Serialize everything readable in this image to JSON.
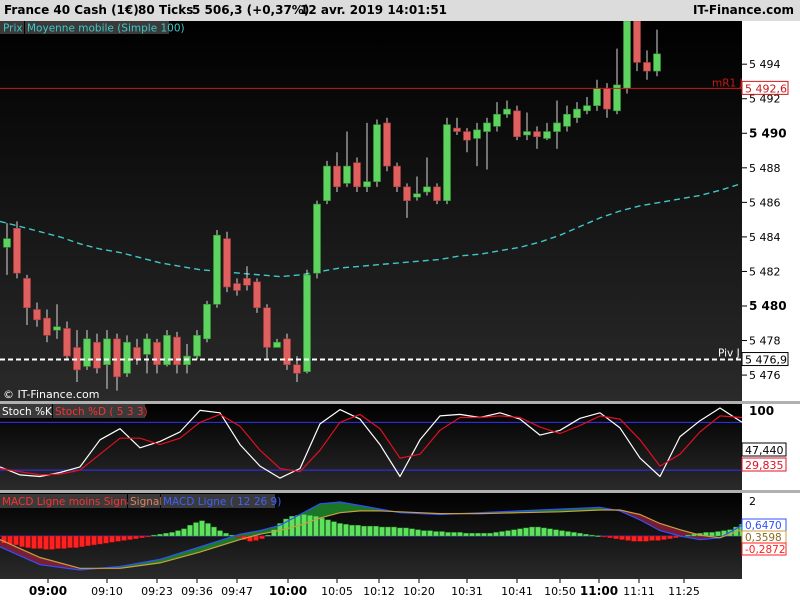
{
  "header": {
    "instrument": "France 40 Cash (1€)",
    "ticks": "80 Ticks",
    "price": "5 506,3 (+0,37%)",
    "datetime": "12 avr. 2019 14:01:51",
    "brand": "IT-Finance.com"
  },
  "watermark": "© IT-Finance.com",
  "price_panel": {
    "legend": [
      "Prix",
      "Moyenne mobile (Simple 100)"
    ],
    "levels": {
      "mr1": {
        "name": "mR1 J",
        "value": "5 492,6",
        "price": 5492.6
      },
      "piv": {
        "name": "Piv J",
        "value": "5 476,9",
        "price": 5476.9
      }
    }
  },
  "stoch_panel": {
    "legend": [
      "Stoch %K",
      "Stoch %D ( 5 3 3)"
    ],
    "readouts": [
      "47,440",
      "29,835"
    ],
    "top_label": "100"
  },
  "macd_panel": {
    "legend": [
      "MACD Ligne moins Signal",
      "Signal",
      "MACD Ligne ( 12 26 9)"
    ],
    "readouts": [
      "0,6470",
      "0,3598",
      "-0,2872"
    ],
    "top_label": "2"
  },
  "colors": {
    "bull": "#5fd35f",
    "bear": "#e06060",
    "ma": "#40c8c8",
    "resistance": "#c81818",
    "pivot": "#ffffff",
    "stoch_k": "#ffffff",
    "stoch_d": "#e01020",
    "macd_pos": "#5fe05f",
    "macd_neg": "#ff2020",
    "guide": "#3030ff"
  },
  "chart_data": [
    {
      "type": "candlestick",
      "ylim": [
        5474.5,
        5496.5
      ],
      "y_ticks": [
        "5 476",
        "5 478",
        "5 480",
        "5 482",
        "5 484",
        "5 486",
        "5 488",
        "5 490",
        "5 492",
        "5 494"
      ],
      "y_tick_values": [
        5476,
        5478,
        5480,
        5482,
        5484,
        5486,
        5488,
        5490,
        5492,
        5494
      ],
      "x_labels": [
        "09:00",
        "09:10",
        "09:23",
        "09:36",
        "09:47",
        "10:00",
        "10:05",
        "10:12",
        "10:20",
        "10:31",
        "10:41",
        "10:50",
        "11:00",
        "11:11",
        "11:25"
      ],
      "candles": [
        {
          "o": 5483.4,
          "c": 5483.9,
          "h": 5484.8,
          "l": 5481.8
        },
        {
          "o": 5484.5,
          "c": 5481.9,
          "h": 5484.9,
          "l": 5481.6
        },
        {
          "o": 5481.6,
          "c": 5479.9,
          "h": 5481.8,
          "l": 5478.9
        },
        {
          "o": 5479.8,
          "c": 5479.2,
          "h": 5480.2,
          "l": 5478.8
        },
        {
          "o": 5479.3,
          "c": 5478.3,
          "h": 5479.8,
          "l": 5477.9
        },
        {
          "o": 5478.6,
          "c": 5478.8,
          "h": 5480.1,
          "l": 5478.1
        },
        {
          "o": 5478.7,
          "c": 5477.1,
          "h": 5479.1,
          "l": 5476.9
        },
        {
          "o": 5477.6,
          "c": 5476.3,
          "h": 5478.6,
          "l": 5475.6
        },
        {
          "o": 5476.5,
          "c": 5478.1,
          "h": 5478.6,
          "l": 5476.3
        },
        {
          "o": 5477.9,
          "c": 5476.4,
          "h": 5478.4,
          "l": 5476.1
        },
        {
          "o": 5476.6,
          "c": 5478.1,
          "h": 5478.6,
          "l": 5475.2
        },
        {
          "o": 5478.1,
          "c": 5475.9,
          "h": 5478.4,
          "l": 5475.1
        },
        {
          "o": 5476.1,
          "c": 5477.9,
          "h": 5478.3,
          "l": 5475.9
        },
        {
          "o": 5477.6,
          "c": 5476.9,
          "h": 5478.1,
          "l": 5476.6
        },
        {
          "o": 5477.2,
          "c": 5478.1,
          "h": 5478.4,
          "l": 5476.1
        },
        {
          "o": 5477.9,
          "c": 5476.6,
          "h": 5478.1,
          "l": 5476.1
        },
        {
          "o": 5476.6,
          "c": 5478.3,
          "h": 5478.6,
          "l": 5476.5
        },
        {
          "o": 5478.2,
          "c": 5476.6,
          "h": 5478.5,
          "l": 5476.1
        },
        {
          "o": 5476.6,
          "c": 5477.1,
          "h": 5477.8,
          "l": 5476.1
        },
        {
          "o": 5477.1,
          "c": 5478.3,
          "h": 5478.6,
          "l": 5476.9
        },
        {
          "o": 5478.1,
          "c": 5480.1,
          "h": 5480.3,
          "l": 5477.9
        },
        {
          "o": 5480.1,
          "c": 5484.1,
          "h": 5484.4,
          "l": 5479.9
        },
        {
          "o": 5483.9,
          "c": 5481.1,
          "h": 5484.3,
          "l": 5480.8
        },
        {
          "o": 5481.3,
          "c": 5480.9,
          "h": 5481.6,
          "l": 5480.6
        },
        {
          "o": 5481.6,
          "c": 5481.2,
          "h": 5482.3,
          "l": 5480.9
        },
        {
          "o": 5481.4,
          "c": 5479.9,
          "h": 5481.6,
          "l": 5479.6
        },
        {
          "o": 5479.9,
          "c": 5477.6,
          "h": 5480.1,
          "l": 5476.9
        },
        {
          "o": 5477.6,
          "c": 5477.9,
          "h": 5478.1,
          "l": 5477.6
        },
        {
          "o": 5478.1,
          "c": 5476.6,
          "h": 5478.4,
          "l": 5476.3
        },
        {
          "o": 5476.6,
          "c": 5476.1,
          "h": 5477.1,
          "l": 5475.6
        },
        {
          "o": 5476.2,
          "c": 5481.8,
          "h": 5482.1,
          "l": 5476.1
        },
        {
          "o": 5481.9,
          "c": 5485.9,
          "h": 5486.1,
          "l": 5481.6
        },
        {
          "o": 5486.1,
          "c": 5488.1,
          "h": 5488.4,
          "l": 5485.9
        },
        {
          "o": 5488.1,
          "c": 5486.9,
          "h": 5488.9,
          "l": 5486.6
        },
        {
          "o": 5487.1,
          "c": 5488.1,
          "h": 5490.1,
          "l": 5486.9
        },
        {
          "o": 5488.3,
          "c": 5486.9,
          "h": 5488.6,
          "l": 5486.6
        },
        {
          "o": 5486.9,
          "c": 5487.2,
          "h": 5490.6,
          "l": 5486.6
        },
        {
          "o": 5487.2,
          "c": 5490.5,
          "h": 5490.8,
          "l": 5486.9
        },
        {
          "o": 5490.6,
          "c": 5488.1,
          "h": 5490.9,
          "l": 5487.8
        },
        {
          "o": 5488.1,
          "c": 5486.9,
          "h": 5488.3,
          "l": 5486.6
        },
        {
          "o": 5486.9,
          "c": 5486.1,
          "h": 5487.1,
          "l": 5485.1
        },
        {
          "o": 5486.3,
          "c": 5486.5,
          "h": 5487.5,
          "l": 5486.1
        },
        {
          "o": 5486.6,
          "c": 5486.9,
          "h": 5488.6,
          "l": 5486.4
        },
        {
          "o": 5486.9,
          "c": 5486.1,
          "h": 5487.1,
          "l": 5485.9
        },
        {
          "o": 5486.1,
          "c": 5490.5,
          "h": 5490.9,
          "l": 5485.9
        },
        {
          "o": 5490.3,
          "c": 5490.1,
          "h": 5490.9,
          "l": 5489.9
        },
        {
          "o": 5490.1,
          "c": 5489.6,
          "h": 5490.3,
          "l": 5488.9
        },
        {
          "o": 5489.7,
          "c": 5490.2,
          "h": 5490.6,
          "l": 5488.1
        },
        {
          "o": 5490.1,
          "c": 5490.6,
          "h": 5490.9,
          "l": 5487.9
        },
        {
          "o": 5490.4,
          "c": 5491.1,
          "h": 5491.8,
          "l": 5490.1
        },
        {
          "o": 5491.1,
          "c": 5491.4,
          "h": 5491.9,
          "l": 5490.9
        },
        {
          "o": 5491.3,
          "c": 5489.8,
          "h": 5491.6,
          "l": 5489.6
        },
        {
          "o": 5489.9,
          "c": 5490.1,
          "h": 5491.2,
          "l": 5489.6
        },
        {
          "o": 5490.1,
          "c": 5489.8,
          "h": 5490.4,
          "l": 5489.1
        },
        {
          "o": 5489.7,
          "c": 5490.1,
          "h": 5490.6,
          "l": 5489.6
        },
        {
          "o": 5490.1,
          "c": 5490.6,
          "h": 5491.9,
          "l": 5489.1
        },
        {
          "o": 5490.4,
          "c": 5491.1,
          "h": 5491.6,
          "l": 5490.1
        },
        {
          "o": 5490.9,
          "c": 5491.4,
          "h": 5491.8,
          "l": 5490.6
        },
        {
          "o": 5491.3,
          "c": 5491.6,
          "h": 5492.1,
          "l": 5491.1
        },
        {
          "o": 5491.6,
          "c": 5492.6,
          "h": 5493.1,
          "l": 5491.3
        },
        {
          "o": 5492.6,
          "c": 5491.4,
          "h": 5492.9,
          "l": 5490.9
        },
        {
          "o": 5491.3,
          "c": 5492.8,
          "h": 5494.9,
          "l": 5491.1
        },
        {
          "o": 5492.6,
          "c": 5496.5,
          "h": 5496.5,
          "l": 5492.3
        },
        {
          "o": 5496.5,
          "c": 5494.1,
          "h": 5496.5,
          "l": 5493.6
        },
        {
          "o": 5494.1,
          "c": 5493.6,
          "h": 5494.8,
          "l": 5493.1
        },
        {
          "o": 5493.6,
          "c": 5494.6,
          "h": 5496.0,
          "l": 5493.3
        }
      ],
      "candle_x": [
        7,
        17,
        27,
        37,
        47,
        57,
        67,
        77,
        87,
        97,
        107,
        117,
        127,
        137,
        147,
        157,
        167,
        177,
        187,
        197,
        207,
        217,
        227,
        237,
        247,
        257,
        267,
        277,
        287,
        297,
        307,
        317,
        327,
        337,
        347,
        357,
        367,
        377,
        387,
        397,
        407,
        417,
        427,
        437,
        447,
        457,
        467,
        477,
        487,
        497,
        507,
        517,
        527,
        537,
        547,
        557,
        567,
        577,
        587,
        597,
        607,
        617,
        627,
        637,
        647,
        657
      ],
      "series_ma": {
        "x": [
          0,
          20,
          40,
          60,
          80,
          100,
          120,
          140,
          160,
          180,
          200,
          220,
          240,
          260,
          280,
          300,
          320,
          340,
          360,
          380,
          400,
          420,
          440,
          460,
          480,
          500,
          520,
          540,
          560,
          580,
          600,
          620,
          640,
          660,
          680,
          700,
          720,
          742
        ],
        "y": [
          5484.9,
          5484.6,
          5484.3,
          5484.0,
          5483.6,
          5483.3,
          5483.1,
          5482.8,
          5482.5,
          5482.3,
          5482.1,
          5482.0,
          5481.9,
          5481.8,
          5481.7,
          5481.8,
          5482.0,
          5482.2,
          5482.3,
          5482.4,
          5482.5,
          5482.6,
          5482.7,
          5482.9,
          5483.0,
          5483.2,
          5483.4,
          5483.7,
          5484.1,
          5484.6,
          5485.1,
          5485.5,
          5485.8,
          5486.0,
          5486.2,
          5486.4,
          5486.7,
          5487.1
        ]
      }
    },
    {
      "type": "line",
      "ylim": [
        -5,
        103
      ],
      "guide_lines": [
        80,
        20
      ],
      "series": [
        {
          "x": [
            0,
            20,
            40,
            60,
            80,
            100,
            120,
            140,
            160,
            180,
            200,
            220,
            240,
            260,
            280,
            300,
            320,
            340,
            360,
            380,
            400,
            420,
            440,
            460,
            480,
            500,
            520,
            540,
            560,
            580,
            600,
            620,
            640,
            660,
            680,
            700,
            720,
            742
          ],
          "y": [
            24,
            14,
            12,
            17,
            24,
            58,
            72,
            48,
            56,
            68,
            95,
            92,
            52,
            25,
            10,
            22,
            78,
            96,
            84,
            52,
            12,
            58,
            88,
            90,
            86,
            92,
            84,
            64,
            70,
            85,
            92,
            73,
            35,
            12,
            62,
            82,
            98,
            80
          ]
        },
        {
          "x": [
            0,
            20,
            40,
            60,
            80,
            100,
            120,
            140,
            160,
            180,
            200,
            220,
            240,
            260,
            280,
            300,
            320,
            340,
            360,
            380,
            400,
            420,
            440,
            460,
            480,
            500,
            520,
            540,
            560,
            580,
            600,
            620,
            640,
            660,
            680,
            700,
            720,
            742
          ],
          "y": [
            22,
            18,
            14,
            15,
            20,
            40,
            60,
            60,
            52,
            60,
            80,
            90,
            75,
            45,
            22,
            18,
            45,
            80,
            90,
            72,
            35,
            40,
            70,
            86,
            86,
            88,
            86,
            74,
            66,
            76,
            88,
            84,
            58,
            25,
            40,
            68,
            88,
            86
          ]
        }
      ]
    },
    {
      "type": "bar",
      "ylim": [
        -2.4,
        2.4
      ],
      "zero": 0,
      "hist_x": [
        4,
        10,
        16,
        22,
        28,
        34,
        40,
        46,
        52,
        58,
        64,
        70,
        76,
        82,
        88,
        94,
        100,
        106,
        112,
        118,
        124,
        130,
        136,
        142,
        148,
        154,
        160,
        166,
        172,
        178,
        184,
        190,
        196,
        202,
        208,
        214,
        220,
        226,
        232,
        238,
        244,
        250,
        256,
        262,
        268,
        274,
        280,
        286,
        292,
        298,
        304,
        310,
        316,
        322,
        328,
        334,
        340,
        346,
        352,
        358,
        364,
        370,
        376,
        382,
        388,
        394,
        400,
        406,
        412,
        418,
        424,
        430,
        436,
        442,
        448,
        454,
        460,
        466,
        472,
        478,
        484,
        490,
        496,
        502,
        508,
        514,
        520,
        526,
        532,
        538,
        544,
        550,
        556,
        562,
        568,
        574,
        580,
        586,
        592,
        598,
        604,
        610,
        616,
        622,
        628,
        634,
        640,
        646,
        652,
        658,
        664,
        670,
        676,
        682,
        688,
        694,
        700,
        706,
        712,
        718,
        724,
        730,
        736,
        742
      ],
      "hist_values": [
        -0.4,
        -0.45,
        -0.5,
        -0.6,
        -0.65,
        -0.7,
        -0.7,
        -0.75,
        -0.75,
        -0.7,
        -0.7,
        -0.65,
        -0.65,
        -0.6,
        -0.55,
        -0.5,
        -0.45,
        -0.4,
        -0.35,
        -0.3,
        -0.25,
        -0.2,
        -0.15,
        -0.1,
        -0.05,
        0.05,
        0.1,
        0.15,
        0.2,
        0.3,
        0.4,
        0.6,
        0.75,
        0.85,
        0.7,
        0.5,
        0.3,
        0.15,
        0.05,
        -0.05,
        -0.2,
        -0.3,
        -0.25,
        -0.15,
        0.05,
        0.35,
        0.7,
        0.95,
        1.1,
        1.15,
        1.2,
        1.15,
        1.1,
        1.0,
        0.9,
        0.8,
        0.7,
        0.65,
        0.6,
        0.6,
        0.55,
        0.55,
        0.55,
        0.5,
        0.5,
        0.5,
        0.45,
        0.45,
        0.4,
        0.35,
        0.3,
        0.3,
        0.25,
        0.25,
        0.2,
        0.2,
        0.2,
        0.15,
        0.15,
        0.15,
        0.15,
        0.15,
        0.2,
        0.25,
        0.3,
        0.35,
        0.4,
        0.45,
        0.5,
        0.5,
        0.45,
        0.4,
        0.35,
        0.3,
        0.25,
        0.2,
        0.15,
        0.1,
        0.05,
        0.02,
        -0.05,
        -0.1,
        -0.15,
        -0.2,
        -0.25,
        -0.3,
        -0.3,
        -0.3,
        -0.25,
        -0.25,
        -0.2,
        -0.15,
        -0.1,
        -0.05,
        0.05,
        0.1,
        0.15,
        0.2,
        0.2,
        0.25,
        0.3,
        0.35,
        0.5,
        0.65
      ],
      "series": [
        {
          "name": "MACD Ligne",
          "x": [
            0,
            40,
            80,
            120,
            160,
            200,
            240,
            260,
            280,
            300,
            320,
            340,
            360,
            380,
            400,
            440,
            480,
            520,
            560,
            600,
            620,
            640,
            660,
            680,
            700,
            720,
            742
          ],
          "y": [
            -0.6,
            -1.6,
            -1.9,
            -1.7,
            -1.3,
            -0.6,
            0.1,
            0.3,
            0.6,
            1.2,
            1.8,
            1.9,
            1.7,
            1.5,
            1.3,
            1.2,
            1.3,
            1.4,
            1.5,
            1.6,
            1.4,
            0.9,
            0.3,
            0.0,
            -0.2,
            -0.1,
            0.6
          ]
        },
        {
          "name": "Signal",
          "x": [
            0,
            40,
            80,
            120,
            160,
            200,
            240,
            260,
            280,
            300,
            320,
            340,
            360,
            380,
            400,
            440,
            480,
            520,
            560,
            600,
            620,
            640,
            660,
            680,
            700,
            720,
            742
          ],
          "y": [
            -0.2,
            -1.2,
            -1.8,
            -1.8,
            -1.5,
            -0.9,
            -0.2,
            0.1,
            0.3,
            0.6,
            1.0,
            1.3,
            1.4,
            1.4,
            1.35,
            1.25,
            1.25,
            1.3,
            1.35,
            1.45,
            1.45,
            1.2,
            0.7,
            0.35,
            0.05,
            -0.1,
            0.35
          ]
        }
      ]
    }
  ]
}
